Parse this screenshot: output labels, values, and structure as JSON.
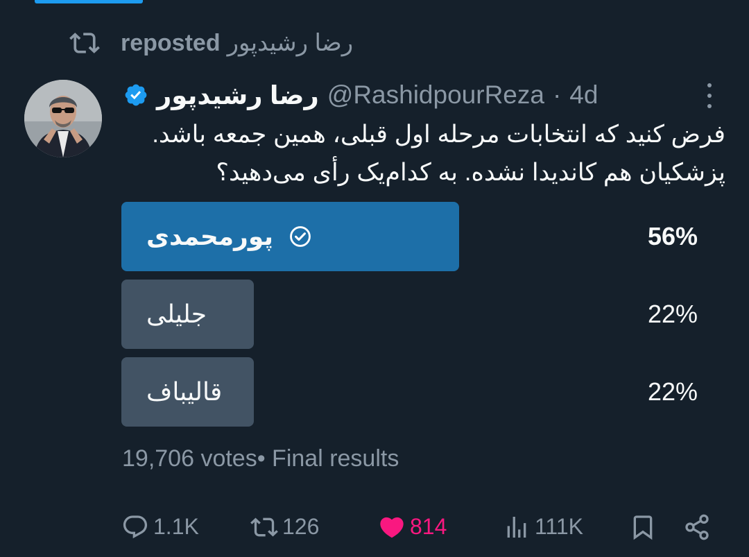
{
  "repost": {
    "reposter": "رضا رشیدپور",
    "label": "reposted"
  },
  "tweet": {
    "display_name": "رضا رشیدپور",
    "handle": "@RashidpourReza",
    "separator": "·",
    "time": "4d",
    "text": "فرض کنید که انتخابات مرحله اول قبلی، همین جمعه باشد. پزشکیان هم کاندیدا نشده. به کدام‌یک رأی می‌دهید؟"
  },
  "poll": {
    "options": [
      {
        "label": "پورمحمدی",
        "percent": "56%",
        "share": 0.56,
        "winner": true
      },
      {
        "label": "جلیلی",
        "percent": "22%",
        "share": 0.22,
        "winner": false
      },
      {
        "label": "قالیباف",
        "percent": "22%",
        "share": 0.22,
        "winner": false
      }
    ],
    "votes": "19,706 votes",
    "status": "• Final results"
  },
  "actions": {
    "replies": "1.1K",
    "reposts": "126",
    "likes": "814",
    "views": "111K"
  },
  "colors": {
    "background": "#15202b",
    "accent": "#1d9bf0",
    "poll_winner": "#1d6fa8",
    "poll_other": "#425364",
    "muted": "#8b98a5",
    "like": "#f91880"
  },
  "icons": [
    "repost-icon",
    "verified-badge-icon",
    "more-icon",
    "check-circle-icon",
    "reply-icon",
    "heart-icon",
    "views-icon",
    "bookmark-icon",
    "share-icon"
  ]
}
